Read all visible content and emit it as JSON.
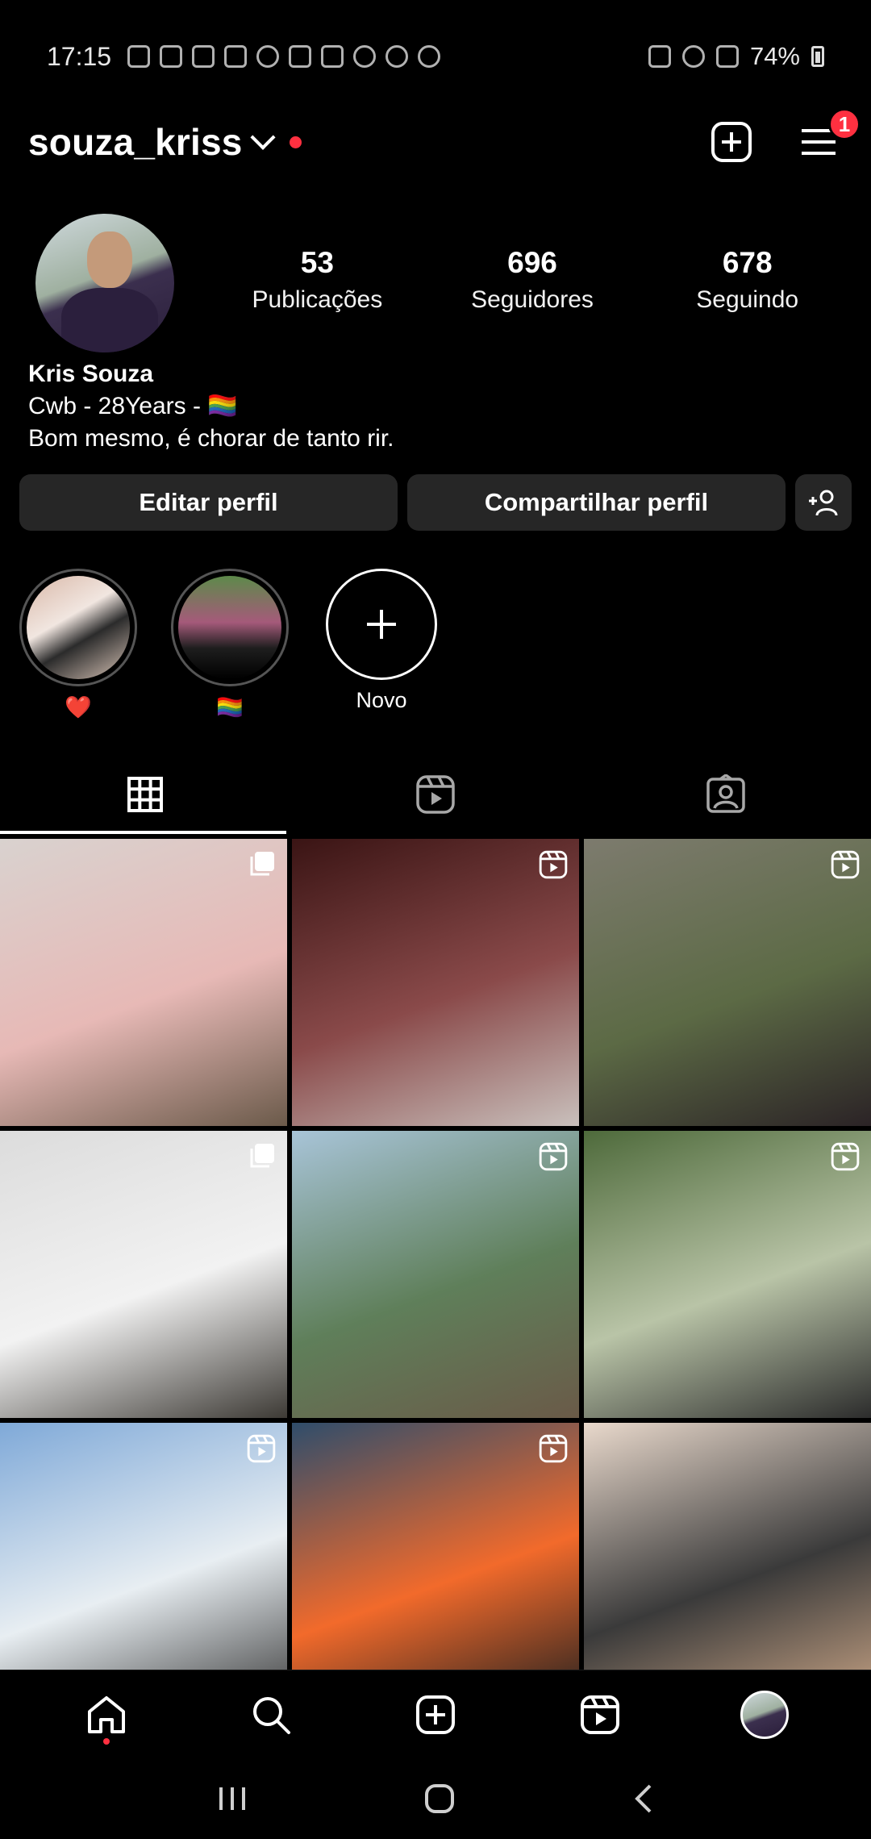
{
  "status_bar": {
    "time": "17:15",
    "battery": "74%"
  },
  "header": {
    "username": "souza_kriss",
    "notification_count": "1"
  },
  "profile": {
    "stats": [
      {
        "value": "53",
        "label": "Publicações"
      },
      {
        "value": "696",
        "label": "Seguidores"
      },
      {
        "value": "678",
        "label": "Seguindo"
      }
    ],
    "name": "Kris Souza",
    "bio_line1": "Cwb - 28Years - 🏳️‍🌈",
    "bio_line2": "Bom mesmo, é chorar de tanto rir."
  },
  "actions": {
    "edit": "Editar perfil",
    "share": "Compartilhar perfil"
  },
  "highlights": [
    {
      "label": "❤️"
    },
    {
      "label": "🏳️‍🌈"
    },
    {
      "label": "Novo"
    }
  ],
  "posts": [
    {
      "type": "carousel",
      "colors": [
        "#d9d2cf",
        "#e7b9b6",
        "#6b5a4a"
      ]
    },
    {
      "type": "reel",
      "colors": [
        "#3a1414",
        "#8a4a4a",
        "#c9c0bc"
      ]
    },
    {
      "type": "reel",
      "colors": [
        "#7d7b6e",
        "#5c6a45",
        "#2b2326"
      ]
    },
    {
      "type": "carousel",
      "colors": [
        "#dcdcdc",
        "#f2f2f2",
        "#3d3a35"
      ]
    },
    {
      "type": "reel",
      "colors": [
        "#a8c4d8",
        "#5f7f5a",
        "#6a5a48"
      ]
    },
    {
      "type": "reel",
      "colors": [
        "#4e6a3b",
        "#b9c4a7",
        "#2c2c2c"
      ]
    },
    {
      "type": "reel",
      "colors": [
        "#7fa9d8",
        "#e8eef2",
        "#3b3b3b"
      ]
    },
    {
      "type": "reel",
      "colors": [
        "#2f4d6b",
        "#f26a2b",
        "#1f1f1f"
      ]
    },
    {
      "type": "photo",
      "colors": [
        "#e9d9cc",
        "#3a3a3a",
        "#caa586"
      ]
    }
  ]
}
